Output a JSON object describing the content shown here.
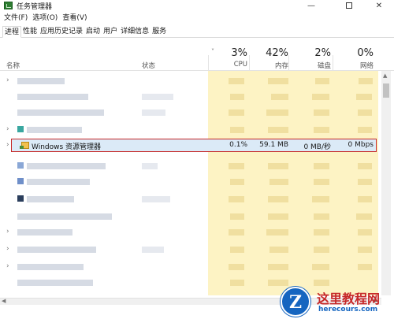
{
  "window": {
    "title": "任务管理器",
    "min_glyph": "—",
    "close_glyph": "✕"
  },
  "menu": [
    "文件(F)",
    "选项(O)",
    "查看(V)"
  ],
  "tabs": [
    "进程",
    "性能",
    "应用历史记录",
    "启动",
    "用户",
    "详细信息",
    "服务"
  ],
  "header": {
    "name_label": "名称",
    "status_label": "状态",
    "cpu": {
      "pct": "3%",
      "label": "CPU"
    },
    "memory": {
      "pct": "42%",
      "label": "内存"
    },
    "disk": {
      "pct": "2%",
      "label": "磁盘"
    },
    "network": {
      "pct": "0%",
      "label": "网络"
    }
  },
  "highlighted_process": {
    "name": "Windows 资源管理器",
    "cpu": "0.1%",
    "memory": "59.1 MB",
    "disk": "0 MB/秒",
    "network": "0 Mbps"
  },
  "watermark": {
    "logo_letter": "Z",
    "title": "这里教程网",
    "url": "herecours.com"
  }
}
